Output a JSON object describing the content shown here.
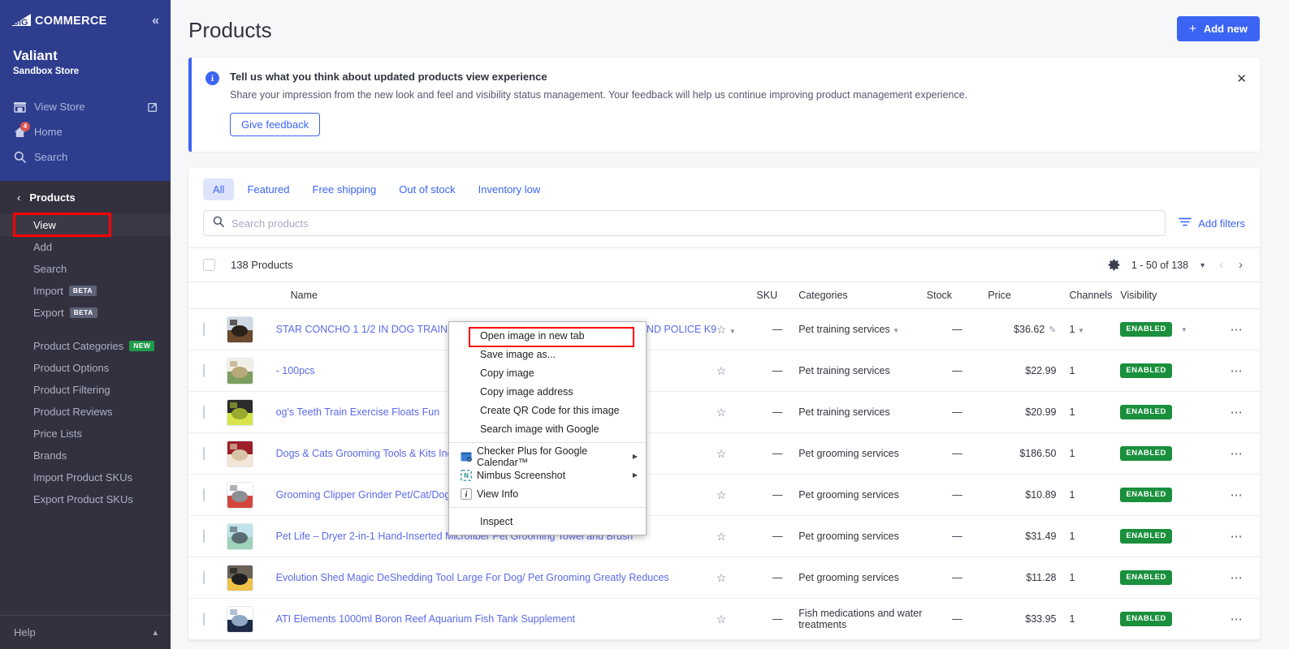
{
  "sidebar": {
    "logo_text": "COMMERCE",
    "collapse_icon": "chevrons-left-icon",
    "store_name": "Valiant",
    "store_sub": "Sandbox Store",
    "nav_top": [
      {
        "label": "View Store",
        "icon": "store-icon",
        "external": true,
        "badge": null
      },
      {
        "label": "Home",
        "icon": "home-icon",
        "external": false,
        "badge": "4"
      },
      {
        "label": "Search",
        "icon": "search-icon",
        "external": false,
        "badge": null
      }
    ],
    "section_title": "Products",
    "back_icon": "chevron-left-icon",
    "items": [
      {
        "label": "View",
        "tag": null,
        "active": true
      },
      {
        "label": "Add",
        "tag": null,
        "active": false
      },
      {
        "label": "Search",
        "tag": null,
        "active": false
      },
      {
        "label": "Import",
        "tag": "BETA",
        "active": false
      },
      {
        "label": "Export",
        "tag": "BETA",
        "active": false
      }
    ],
    "items2": [
      {
        "label": "Product Categories",
        "tag": "NEW"
      },
      {
        "label": "Product Options",
        "tag": null
      },
      {
        "label": "Product Filtering",
        "tag": null
      },
      {
        "label": "Product Reviews",
        "tag": null
      },
      {
        "label": "Price Lists",
        "tag": null
      },
      {
        "label": "Brands",
        "tag": null
      },
      {
        "label": "Import Product SKUs",
        "tag": null
      },
      {
        "label": "Export Product SKUs",
        "tag": null
      }
    ],
    "help_label": "Help",
    "help_caret": "chevron-up-icon"
  },
  "header": {
    "title": "Products",
    "add_new_label": "Add new",
    "add_new_icon": "plus-icon"
  },
  "banner": {
    "icon": "info-icon",
    "title": "Tell us what you think about updated products view experience",
    "body": "Share your impression from the new look and feel and visibility status management. Your feedback will help us continue improving product management experience.",
    "button_label": "Give feedback",
    "close_icon": "close-icon"
  },
  "filters": {
    "tabs": [
      {
        "label": "All",
        "active": true
      },
      {
        "label": "Featured",
        "active": false
      },
      {
        "label": "Free shipping",
        "active": false
      },
      {
        "label": "Out of stock",
        "active": false
      },
      {
        "label": "Inventory low",
        "active": false
      }
    ],
    "search_placeholder": "Search products",
    "search_value": "",
    "search_icon": "search-icon",
    "add_filters_label": "Add filters",
    "add_filters_icon": "filter-icon"
  },
  "list": {
    "count_label": "138 Products",
    "settings_icon": "gear-icon",
    "page_range": "1 - 50 of 138",
    "page_caret_icon": "chevron-down-icon",
    "prev_icon": "chevron-left-icon",
    "next_icon": "chevron-right-icon",
    "columns": [
      "Name",
      "SKU",
      "Categories",
      "Stock",
      "Price",
      "Channels",
      "Visibility"
    ],
    "rows": [
      {
        "name": "STAR CONCHO 1 1/2 IN DOG TRAINING COLLAR CUSTOM MADE SCHUTZHUND POLICE K9",
        "sku": "—",
        "category": "Pet training services",
        "category_caret": true,
        "stock": "—",
        "price": "$36.62",
        "price_editable": true,
        "channels": "1",
        "channels_caret": true,
        "visibility": "ENABLED",
        "visibility_caret": true,
        "star_caret": true,
        "thumb": "dog-collar-photo"
      },
      {
        "name": "- 100pcs",
        "sku": "—",
        "category": "Pet training services",
        "category_caret": false,
        "stock": "—",
        "price": "$22.99",
        "price_editable": false,
        "channels": "1",
        "channels_caret": false,
        "visibility": "ENABLED",
        "visibility_caret": false,
        "star_caret": false,
        "thumb": "sign-photo"
      },
      {
        "name": "og's Teeth Train Exercise Floats Fun",
        "sku": "—",
        "category": "Pet training services",
        "category_caret": false,
        "stock": "—",
        "price": "$20.99",
        "price_editable": false,
        "channels": "1",
        "channels_caret": false,
        "visibility": "ENABLED",
        "visibility_caret": false,
        "star_caret": false,
        "thumb": "tennis-balls-photo"
      },
      {
        "name": "Dogs & Cats Grooming Tools & Kits Inclu",
        "sku": "—",
        "category": "Pet grooming services",
        "category_caret": false,
        "stock": "—",
        "price": "$186.50",
        "price_editable": false,
        "channels": "1",
        "channels_caret": false,
        "visibility": "ENABLED",
        "visibility_caret": false,
        "star_caret": false,
        "thumb": "grooming-kit-photo"
      },
      {
        "name": "Grooming Clipper Grinder Pet/Cat/Dog.",
        "sku": "—",
        "category": "Pet grooming services",
        "category_caret": false,
        "stock": "—",
        "price": "$10.89",
        "price_editable": false,
        "channels": "1",
        "channels_caret": false,
        "visibility": "ENABLED",
        "visibility_caret": false,
        "star_caret": false,
        "thumb": "clipper-photo"
      },
      {
        "name": "Pet Life – Dryer 2-in-1 Hand-Inserted Microfiber Pet Grooming Towel and Brush",
        "sku": "—",
        "category": "Pet grooming services",
        "category_caret": false,
        "stock": "—",
        "price": "$31.49",
        "price_editable": false,
        "channels": "1",
        "channels_caret": false,
        "visibility": "ENABLED",
        "visibility_caret": false,
        "star_caret": false,
        "thumb": "towel-photo"
      },
      {
        "name": "Evolution Shed Magic DeShedding Tool Large For Dog/ Pet Grooming Greatly Reduces",
        "sku": "—",
        "category": "Pet grooming services",
        "category_caret": false,
        "stock": "—",
        "price": "$11.28",
        "price_editable": false,
        "channels": "1",
        "channels_caret": false,
        "visibility": "ENABLED",
        "visibility_caret": false,
        "star_caret": false,
        "thumb": "deshedding-tool-photo"
      },
      {
        "name": "ATI Elements 1000ml Boron Reef Aquarium Fish Tank Supplement",
        "sku": "—",
        "category": "Fish medications and water treatments",
        "category_caret": false,
        "stock": "—",
        "price": "$33.95",
        "price_editable": false,
        "channels": "1",
        "channels_caret": false,
        "visibility": "ENABLED",
        "visibility_caret": false,
        "star_caret": false,
        "thumb": "bottle-photo"
      }
    ]
  },
  "context_menu": {
    "items": [
      {
        "label": "Open image in new tab",
        "icon": null,
        "submenu": false,
        "highlighted": true
      },
      {
        "label": "Save image as...",
        "icon": null,
        "submenu": false,
        "highlighted": false
      },
      {
        "label": "Copy image",
        "icon": null,
        "submenu": false,
        "highlighted": false
      },
      {
        "label": "Copy image address",
        "icon": null,
        "submenu": false,
        "highlighted": false
      },
      {
        "label": "Create QR Code for this image",
        "icon": null,
        "submenu": false,
        "highlighted": false
      },
      {
        "label": "Search image with Google",
        "icon": null,
        "submenu": false,
        "highlighted": false
      },
      {
        "separator": true
      },
      {
        "label": "Checker Plus for Google Calendar™",
        "icon": "calendar-extension-icon",
        "submenu": true,
        "highlighted": false
      },
      {
        "label": "Nimbus Screenshot",
        "icon": "nimbus-icon",
        "submenu": true,
        "highlighted": false
      },
      {
        "label": "View Info",
        "icon": "info-italic-icon",
        "submenu": false,
        "highlighted": false
      },
      {
        "separator": true
      },
      {
        "label": "Inspect",
        "icon": null,
        "submenu": false,
        "highlighted": false
      }
    ]
  },
  "colors": {
    "sidebar_top": "#2e3d8e",
    "sidebar_body": "#34313f",
    "accent": "#3c64f4",
    "link": "#5b6ae8",
    "enabled_badge": "#1a8f3c",
    "new_badge": "#1f9c4a",
    "highlight_red": "#ff0000",
    "page_bg": "#f6f7f9"
  }
}
